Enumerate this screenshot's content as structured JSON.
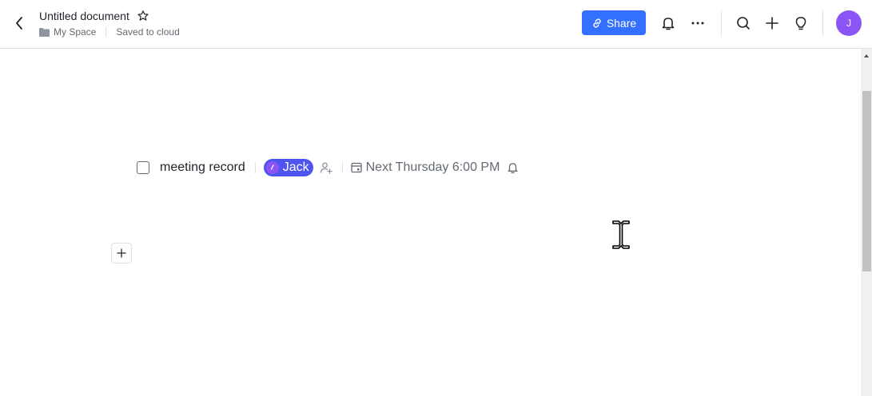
{
  "header": {
    "title": "Untitled document",
    "breadcrumb_space": "My Space",
    "save_status": "Saved to cloud",
    "share_label": "Share",
    "avatar_initial": "J"
  },
  "task": {
    "title": "meeting record",
    "mention": "Jack",
    "due": "Next Thursday 6:00 PM"
  },
  "icons": [
    "back-arrow-icon",
    "star-icon",
    "folder-icon",
    "link-icon",
    "bell-icon",
    "more-icon",
    "search-icon",
    "plus-icon",
    "lightbulb-icon",
    "checkbox",
    "add-assignee-icon",
    "calendar-icon",
    "reminder-bell-icon",
    "add-block-plus-icon",
    "text-cursor-icon"
  ],
  "colors": {
    "accent": "#3370ff",
    "mention": "#4e55ee",
    "avatar": "#8b55f5",
    "text": "#1f2329",
    "secondary_text": "#646a73"
  }
}
